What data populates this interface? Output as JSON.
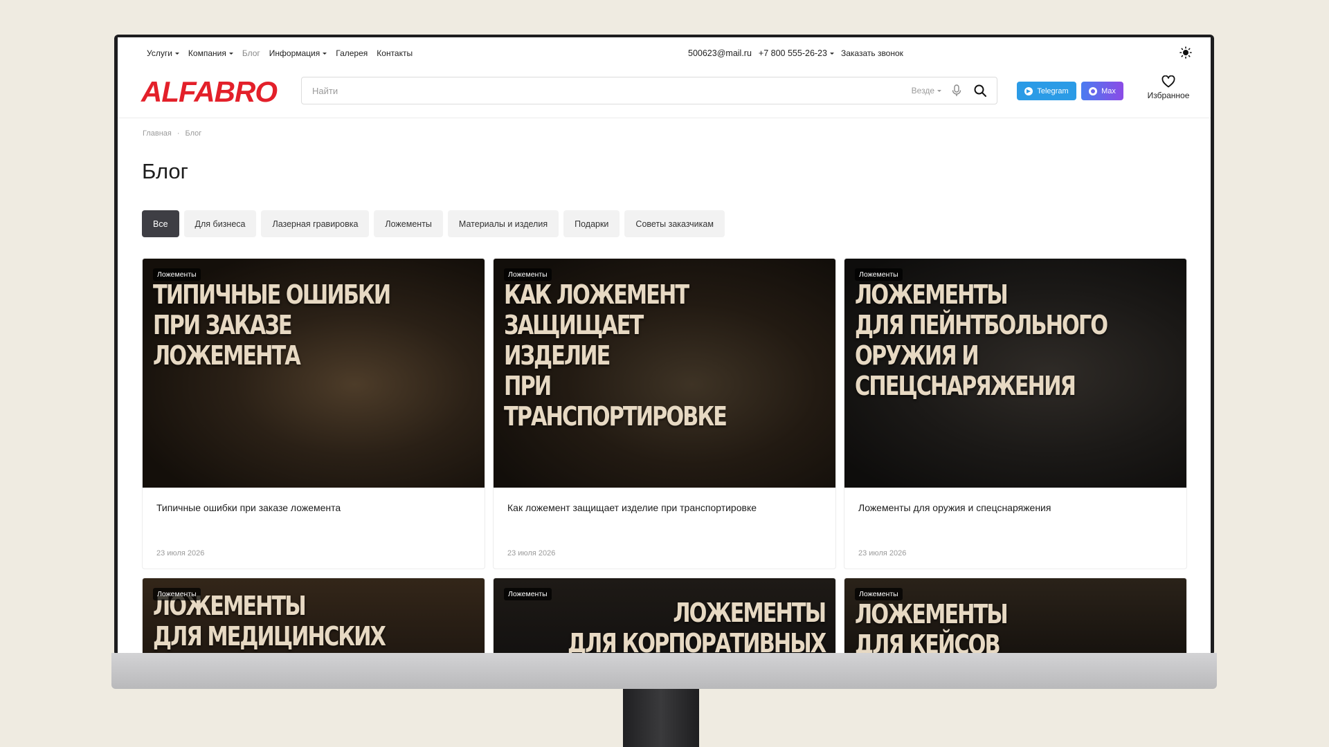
{
  "topnav": {
    "items": [
      {
        "label": "Услуги",
        "dropdown": true
      },
      {
        "label": "Компания",
        "dropdown": true
      },
      {
        "label": "Блог",
        "dropdown": false,
        "current": true
      },
      {
        "label": "Информация",
        "dropdown": true
      },
      {
        "label": "Галерея",
        "dropdown": false
      },
      {
        "label": "Контакты",
        "dropdown": false
      }
    ],
    "email": "500623@mail.ru",
    "phone": "+7 800 555-26-23",
    "callback": "Заказать звонок",
    "theme_icon": "sun-icon"
  },
  "header": {
    "logo": "ALFABRO",
    "search_placeholder": "Найти",
    "search_scope": "Везде",
    "telegram_label": "Telegram",
    "max_label": "Max",
    "favorites_label": "Избранное",
    "colors": {
      "brand": "#e3202a",
      "telegram": "#2b9be6",
      "max": "#6b63ea"
    }
  },
  "breadcrumb": [
    "Главная",
    "Блог"
  ],
  "page_title": "Блог",
  "filters": [
    {
      "label": "Все",
      "active": true
    },
    {
      "label": "Для бизнеса",
      "active": false
    },
    {
      "label": "Лазерная гравировка",
      "active": false
    },
    {
      "label": "Ложементы",
      "active": false
    },
    {
      "label": "Материалы и изделия",
      "active": false
    },
    {
      "label": "Подарки",
      "active": false
    },
    {
      "label": "Советы заказчикам",
      "active": false
    }
  ],
  "cards": [
    {
      "tag": "Ложементы",
      "headline": "ТИПИЧНЫЕ ОШИБКИ\nПРИ ЗАКАЗЕ\nЛОЖЕМЕНТА",
      "title": "Типичные ошибки при заказе ложемента",
      "date": "23 июля 2026"
    },
    {
      "tag": "Ложементы",
      "headline": "КАК ЛОЖЕМЕНТ\nЗАЩИЩАЕТ\nИЗДЕЛИЕ\nПРИ\nТРАНСПОРТИРОВКЕ",
      "title": "Как ложемент защищает изделие при транспортировке",
      "date": "23 июля 2026"
    },
    {
      "tag": "Ложементы",
      "headline": "ЛОЖЕМЕНТЫ\nДЛЯ ПЕЙНТБОЛЬНОГО\nОРУЖИЯ И\nСПЕЦСНАРЯЖЕНИЯ",
      "title": "Ложементы для оружия и спецснаряжения",
      "date": "23 июля 2026"
    },
    {
      "tag": "Ложементы",
      "headline": "ЛОЖЕМЕНТЫ\nДЛЯ МЕДИЦИНСКИХ"
    },
    {
      "tag": "Ложементы",
      "headline": "ЛОЖЕМЕНТЫ\nДЛЯ КОРПОРАТИВНЫХ"
    },
    {
      "tag": "Ложементы",
      "headline": "ЛОЖЕМЕНТЫ\nДЛЯ КЕЙСОВ"
    }
  ]
}
